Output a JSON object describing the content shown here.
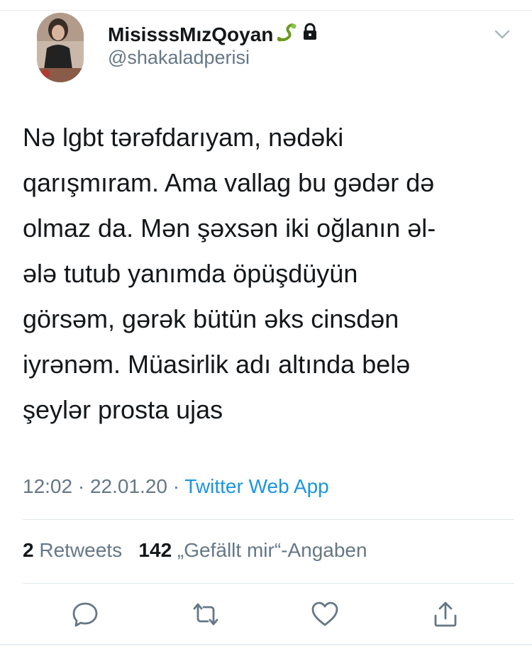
{
  "author": {
    "display_name": "MisisssMızQoyan",
    "handle": "@shakaladperisi"
  },
  "tweet": {
    "lines": [
      "Nə lgbt tərəfdarıyam, nədəki",
      "qarışmıram. Ama vallag bu gədər də",
      "olmaz da. Mən şəxsən iki oğlanın əl-",
      "ələ tutub yanımda öpüşdüyün",
      "görsəm, gərək bütün əks cinsdən",
      "iyrənəm. Müasirlik adı altında belə",
      "şeylər prosta ujas"
    ]
  },
  "meta": {
    "time": "12:02",
    "date": "22.01.20",
    "separator": "·",
    "source": "Twitter Web App"
  },
  "stats": {
    "retweets_count": "2",
    "retweets_label": "Retweets",
    "likes_count": "142",
    "likes_label": "„Gefällt mir“-Angaben"
  },
  "icons": {
    "verified_emoji": "snake-emoji-icon",
    "lock": "lock-icon",
    "menu": "chevron-down-icon",
    "reply": "reply-icon",
    "retweet": "retweet-icon",
    "like": "heart-icon",
    "share": "share-icon"
  },
  "colors": {
    "text": "#14171a",
    "secondary": "#657786",
    "link": "#1b95e0",
    "divider": "#e1e8ed"
  }
}
